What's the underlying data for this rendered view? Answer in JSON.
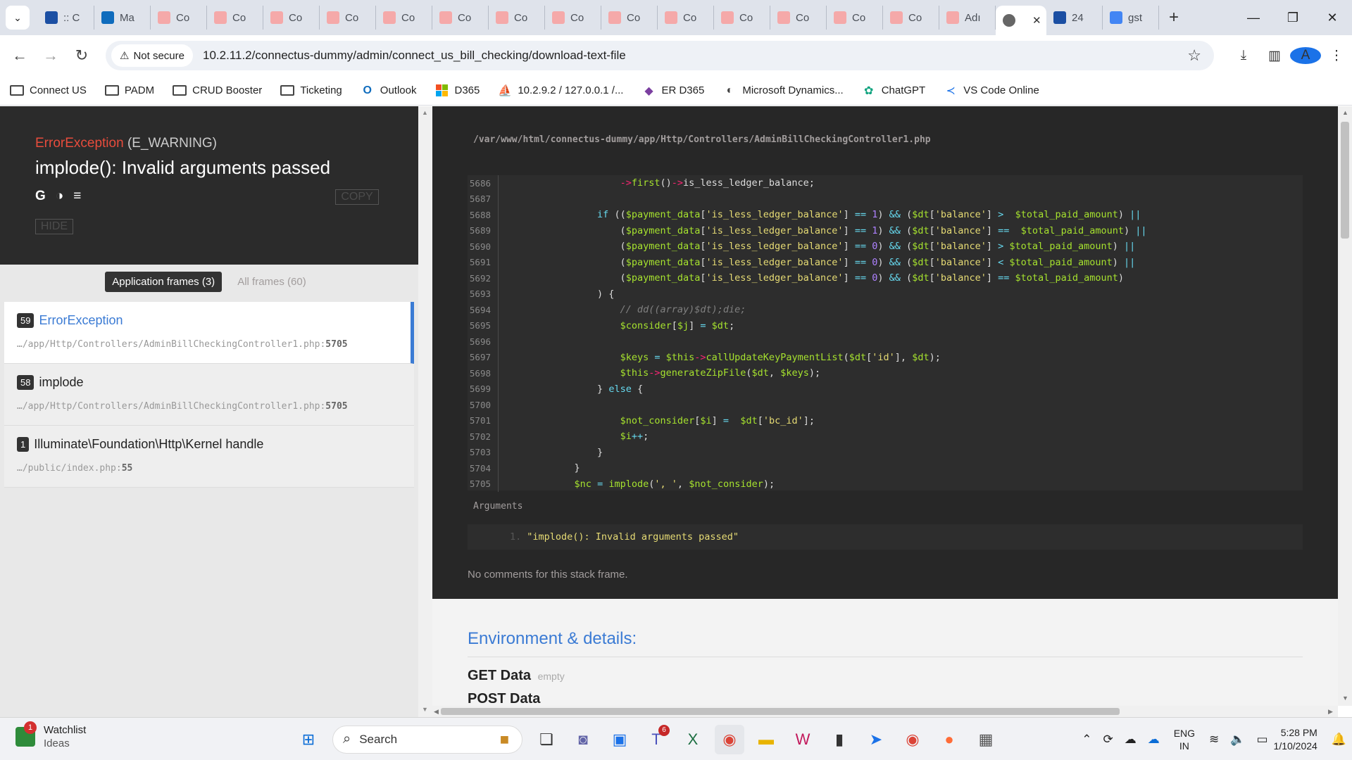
{
  "browser": {
    "tabs": [
      {
        "label": ":: C",
        "color": "#1b4fa3"
      },
      {
        "label": "Ma",
        "color": "#0f6cbd"
      },
      {
        "label": "Co",
        "color": "#f5a9a9"
      },
      {
        "label": "Co",
        "color": "#f5a9a9"
      },
      {
        "label": "Co",
        "color": "#f5a9a9"
      },
      {
        "label": "Co",
        "color": "#f5a9a9"
      },
      {
        "label": "Co",
        "color": "#f5a9a9"
      },
      {
        "label": "Co",
        "color": "#f5a9a9"
      },
      {
        "label": "Co",
        "color": "#f5a9a9"
      },
      {
        "label": "Co",
        "color": "#f5a9a9"
      },
      {
        "label": "Co",
        "color": "#f5a9a9"
      },
      {
        "label": "Co",
        "color": "#f5a9a9"
      },
      {
        "label": "Co",
        "color": "#f5a9a9"
      },
      {
        "label": "Co",
        "color": "#f5a9a9"
      },
      {
        "label": "Co",
        "color": "#f5a9a9"
      },
      {
        "label": "Co",
        "color": "#f5a9a9"
      },
      {
        "label": "Adı",
        "color": "#f5a9a9"
      }
    ],
    "active_tab_close": "✕",
    "after_tabs": [
      {
        "label": "24",
        "color": "#1b4fa3"
      },
      {
        "label": "gst",
        "color": "#4285f4"
      }
    ],
    "security_label": "Not secure",
    "url": "10.2.11.2/connectus-dummy/admin/connect_us_bill_checking/download-text-file",
    "avatar_letter": "A"
  },
  "bookmarks": [
    {
      "label": "Connect US",
      "icon": "folder-icon"
    },
    {
      "label": "PADM",
      "icon": "folder-icon"
    },
    {
      "label": "CRUD Booster",
      "icon": "folder-icon"
    },
    {
      "label": "Ticketing",
      "icon": "folder-icon"
    },
    {
      "label": "Outlook",
      "icon": "outlook-icon"
    },
    {
      "label": "D365",
      "icon": "microsoft-icon"
    },
    {
      "label": "10.2.9.2 / 127.0.0.1 /...",
      "icon": "phpmyadmin-icon"
    },
    {
      "label": "ER D365",
      "icon": "diamond-icon"
    },
    {
      "label": "Microsoft Dynamics...",
      "icon": "dynamics-icon"
    },
    {
      "label": "ChatGPT",
      "icon": "chatgpt-icon"
    },
    {
      "label": "VS Code Online",
      "icon": "vscode-icon"
    }
  ],
  "exception": {
    "class": "ErrorException",
    "type": "(E_WARNING)",
    "message": "implode(): Invalid arguments passed",
    "copy_label": "COPY",
    "hide_label": "HIDE"
  },
  "frame_tabs": {
    "application": "Application frames (3)",
    "all": "All frames (60)"
  },
  "frames": [
    {
      "index": "59",
      "class": "ErrorException",
      "file": "…/app/Http/Controllers/AdminBillCheckingController1.php",
      "line": "5705",
      "active": true
    },
    {
      "index": "58",
      "class": "implode",
      "file": "…/app/Http/Controllers/AdminBillCheckingController1.php",
      "line": "5705",
      "active": false
    },
    {
      "index": "1",
      "class": "Illuminate\\Foundation\\Http\\Kernel handle",
      "file": "…/public/index.php",
      "line": "55",
      "active": false
    }
  ],
  "code": {
    "file_path": "/var/www/html/connectus-dummy/app/Http/Controllers/AdminBillCheckingController1.php",
    "lines": [
      {
        "num": "5686",
        "text": "                    ->first()->is_less_ledger_balance;"
      },
      {
        "num": "5687",
        "text": ""
      },
      {
        "num": "5688",
        "text": "                if (($payment_data['is_less_ledger_balance'] == 1) && ($dt['balance'] >  $total_paid_amount) ||"
      },
      {
        "num": "5689",
        "text": "                    ($payment_data['is_less_ledger_balance'] == 1) && ($dt['balance'] ==  $total_paid_amount) ||"
      },
      {
        "num": "5690",
        "text": "                    ($payment_data['is_less_ledger_balance'] == 0) && ($dt['balance'] > $total_paid_amount) ||"
      },
      {
        "num": "5691",
        "text": "                    ($payment_data['is_less_ledger_balance'] == 0) && ($dt['balance'] < $total_paid_amount) ||"
      },
      {
        "num": "5692",
        "text": "                    ($payment_data['is_less_ledger_balance'] == 0) && ($dt['balance'] == $total_paid_amount)"
      },
      {
        "num": "5693",
        "text": "                ) {"
      },
      {
        "num": "5694",
        "text": "                    // dd((array)$dt);die;"
      },
      {
        "num": "5695",
        "text": "                    $consider[$j] = $dt;"
      },
      {
        "num": "5696",
        "text": ""
      },
      {
        "num": "5697",
        "text": "                    $keys = $this->callUpdateKeyPaymentList($dt['id'], $dt);"
      },
      {
        "num": "5698",
        "text": "                    $this->generateZipFile($dt, $keys);"
      },
      {
        "num": "5699",
        "text": "                } else {"
      },
      {
        "num": "5700",
        "text": ""
      },
      {
        "num": "5701",
        "text": "                    $not_consider[$i] =  $dt['bc_id'];"
      },
      {
        "num": "5702",
        "text": "                    $i++;"
      },
      {
        "num": "5703",
        "text": "                }"
      },
      {
        "num": "5704",
        "text": "            }"
      },
      {
        "num": "5705",
        "text": "            $nc = implode(', ', $not_consider);"
      }
    ],
    "arguments_label": "Arguments",
    "argument_index": "1.",
    "argument_value": "\"implode(): Invalid arguments passed\"",
    "no_comments": "No comments for this stack frame."
  },
  "environment": {
    "title": "Environment & details:",
    "get_label": "GET Data",
    "get_value": "empty",
    "post_label": "POST Data"
  },
  "taskbar": {
    "widget_title": "Watchlist",
    "widget_sub": "Ideas",
    "widget_badge": "1",
    "search_placeholder": "Search",
    "teams_badge": "6",
    "lang_top": "ENG",
    "lang_bottom": "IN",
    "time": "5:28 PM",
    "date": "1/10/2024"
  }
}
